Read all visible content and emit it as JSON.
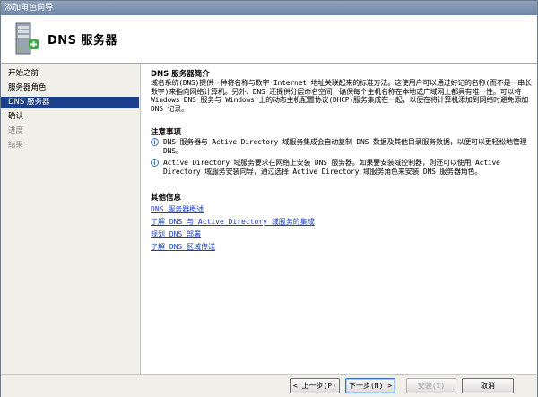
{
  "window": {
    "title": "添加角色向导"
  },
  "banner": {
    "title": "DNS 服务器",
    "icon": "server-add-icon"
  },
  "sidebar": {
    "items": [
      {
        "label": "开始之前",
        "state": "normal"
      },
      {
        "label": "服务器角色",
        "state": "normal"
      },
      {
        "label": "DNS 服务器",
        "state": "active"
      },
      {
        "label": "确认",
        "state": "normal"
      },
      {
        "label": "进度",
        "state": "disabled"
      },
      {
        "label": "结果",
        "state": "disabled"
      }
    ]
  },
  "content": {
    "intro_title": "DNS 服务器简介",
    "intro_text": "域名系统(DNS)提供一种将名称与数字 Internet 地址关联起来的标准方法。这使用户可以通过好记的名称(而不是一串长数字)来指向网络计算机。另外，DNS 还提供分层命名空间，确保每个主机名称在本地或广域网上都具有唯一性。可以将 Windows DNS 服务与 Windows 上的动态主机配置协议(DHCP)服务集成在一起，以便在将计算机添加到网络时避免添加 DNS 记录。",
    "notes_title": "注意事项",
    "notes": [
      "DNS 服务器与 Active Directory 域服务集成会自动复制 DNS 数据及其他目录服务数据，以便可以更轻松地管理 DNS。",
      "Active Directory 域服务要求在网络上安装 DNS 服务器。如果要安装域控制器，则还可以使用 Active Directory 域服务安装向导，通过选择 Active Directory 域服务角色来安装 DNS 服务器角色。"
    ],
    "more_title": "其他信息",
    "links": [
      "DNS 服务器概述",
      "了解 DNS 与 Active Directory 域服务的集成",
      "规划 DNS 部署",
      "了解 DNS 区域传送"
    ]
  },
  "footer": {
    "prev_label": "< 上一步(P)",
    "next_label": "下一步(N) >",
    "install_label": "安装(I)",
    "cancel_label": "取消"
  }
}
